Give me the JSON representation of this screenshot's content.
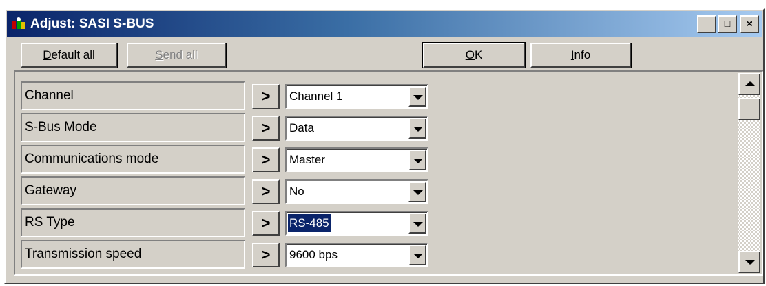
{
  "window": {
    "title": "Adjust: SASI S-BUS",
    "controls": {
      "minimize": "_",
      "maximize": "□",
      "close": "×"
    }
  },
  "toolbar": {
    "default_all": {
      "prefix": "",
      "mnemonic": "D",
      "rest": "efault all"
    },
    "send_all": {
      "prefix": "",
      "mnemonic": "S",
      "rest": "end all"
    },
    "ok": {
      "prefix": "",
      "mnemonic": "O",
      "rest": "K"
    },
    "info": {
      "prefix": "",
      "mnemonic": "I",
      "rest": "nfo"
    }
  },
  "rows": [
    {
      "label": "Channel",
      "arrow": ">",
      "value": "Channel 1"
    },
    {
      "label": "S-Bus Mode",
      "arrow": ">",
      "value": "Data"
    },
    {
      "label": "Communications mode",
      "arrow": ">",
      "value": "Master"
    },
    {
      "label": "Gateway",
      "arrow": ">",
      "value": "No"
    },
    {
      "label": "RS Type",
      "arrow": ">",
      "value": "RS-485",
      "selected": true
    },
    {
      "label": "Transmission speed",
      "arrow": ">",
      "value": "9600 bps"
    }
  ],
  "colors": {
    "title_start": "#0a246a",
    "title_end": "#a6caf0",
    "face": "#d4d0c8",
    "selection": "#0a246a"
  }
}
